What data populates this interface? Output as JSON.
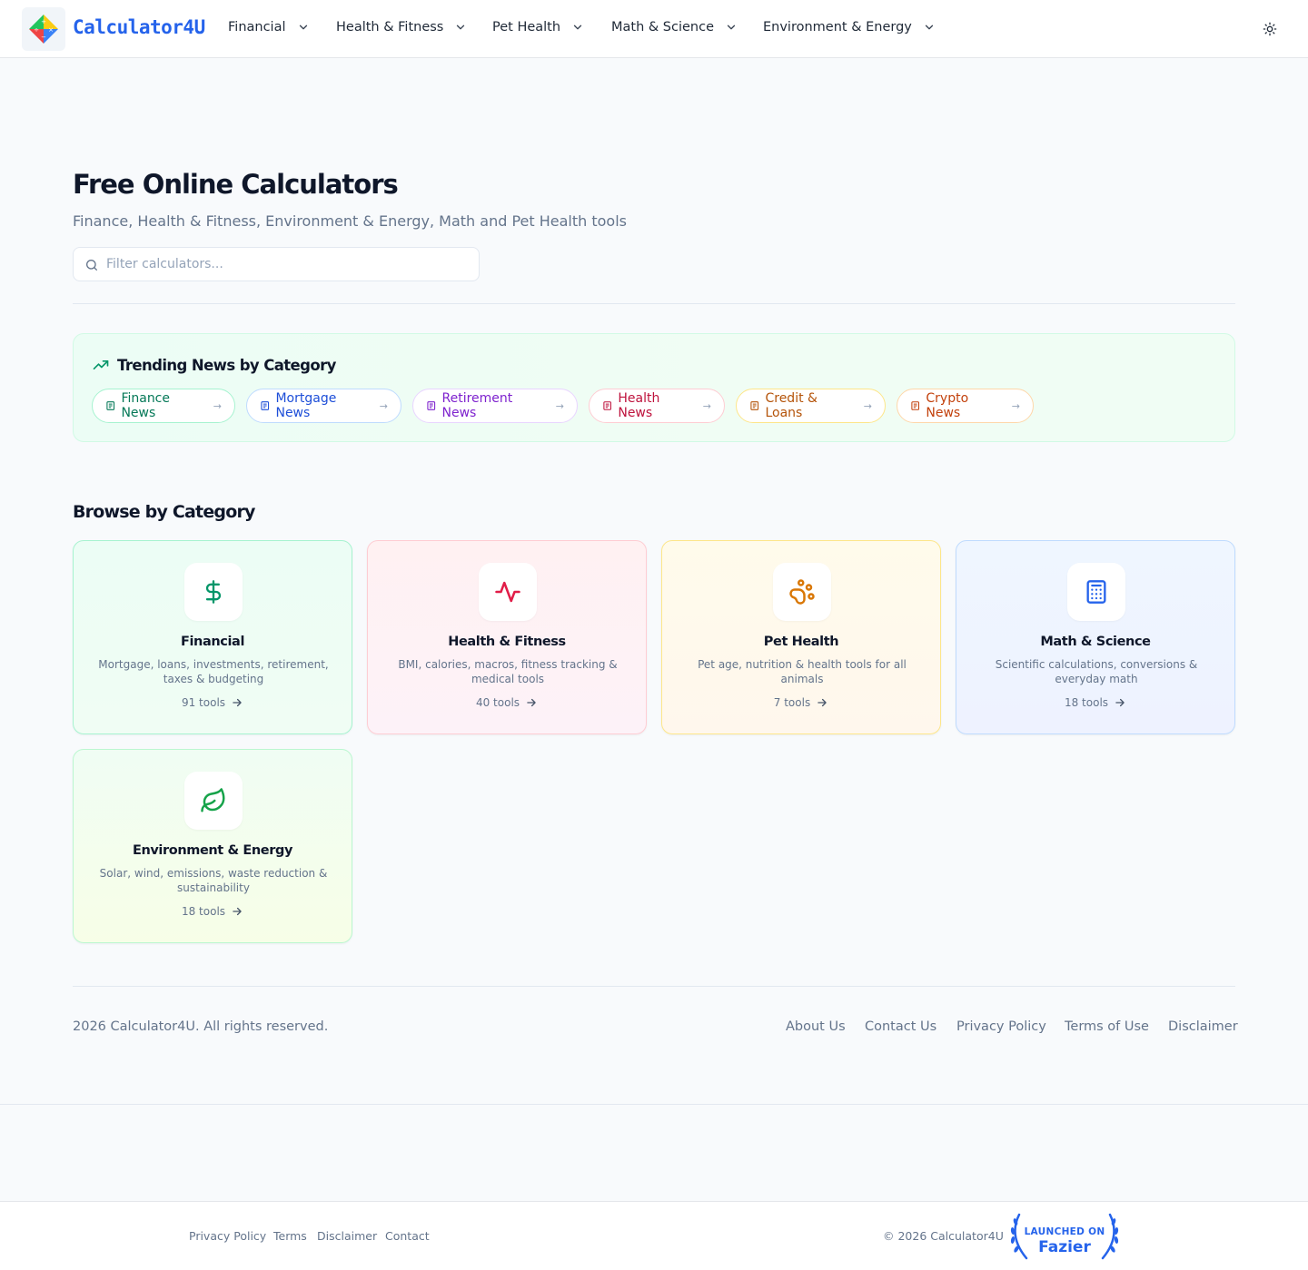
{
  "header": {
    "logo_text": "Calculator4U",
    "nav": [
      {
        "label": "Financial"
      },
      {
        "label": "Health & Fitness"
      },
      {
        "label": "Pet Health"
      },
      {
        "label": "Math & Science"
      },
      {
        "label": "Environment & Energy"
      }
    ]
  },
  "hero": {
    "title": "Free Online Calculators",
    "subtitle": "Finance, Health & Fitness, Environment & Energy, Math and Pet Health tools",
    "search_placeholder": "Filter calculators..."
  },
  "trending": {
    "title": "Trending News by Category",
    "pills": [
      {
        "label": "Finance News",
        "color": "#047857",
        "border": "#a7f3d0"
      },
      {
        "label": "Mortgage News",
        "color": "#1d4ed8",
        "border": "#bfdbfe"
      },
      {
        "label": "Retirement News",
        "color": "#7e22ce",
        "border": "#e9d5ff"
      },
      {
        "label": "Health News",
        "color": "#be123c",
        "border": "#fecdd3"
      },
      {
        "label": "Credit & Loans",
        "color": "#b45309",
        "border": "#fde68a"
      },
      {
        "label": "Crypto News",
        "color": "#c2410c",
        "border": "#fed7aa"
      }
    ]
  },
  "browse": {
    "title": "Browse by Category",
    "cards": [
      {
        "title": "Financial",
        "desc": "Mortgage, loans, investments, retirement, taxes & budgeting",
        "count": "91 tools",
        "icon": "dollar-icon",
        "accent": "#059669"
      },
      {
        "title": "Health & Fitness",
        "desc": "BMI, calories, macros, fitness tracking & medical tools",
        "count": "40 tools",
        "icon": "activity-icon",
        "accent": "#e11d48"
      },
      {
        "title": "Pet Health",
        "desc": "Pet age, nutrition & health tools for all animals",
        "count": "7 tools",
        "icon": "paw-icon",
        "accent": "#d97706"
      },
      {
        "title": "Math & Science",
        "desc": "Scientific calculations, conversions & everyday math",
        "count": "18 tools",
        "icon": "calculator-icon",
        "accent": "#2563eb"
      },
      {
        "title": "Environment & Energy",
        "desc": "Solar, wind, emissions, waste reduction & sustainability",
        "count": "18 tools",
        "icon": "leaf-icon",
        "accent": "#16a34a"
      }
    ]
  },
  "footer": {
    "copyright": "2026 Calculator4U. All rights reserved.",
    "links": [
      "About Us",
      "Contact Us",
      "Privacy Policy",
      "Terms of Use",
      "Disclaimer"
    ]
  },
  "bottom_bar": {
    "links": [
      "Privacy Policy",
      "Terms",
      "Disclaimer",
      "Contact"
    ],
    "copyright": "© 2026 Calculator4U",
    "badge_line1": "LAUNCHED ON",
    "badge_line2": "Fazier"
  }
}
